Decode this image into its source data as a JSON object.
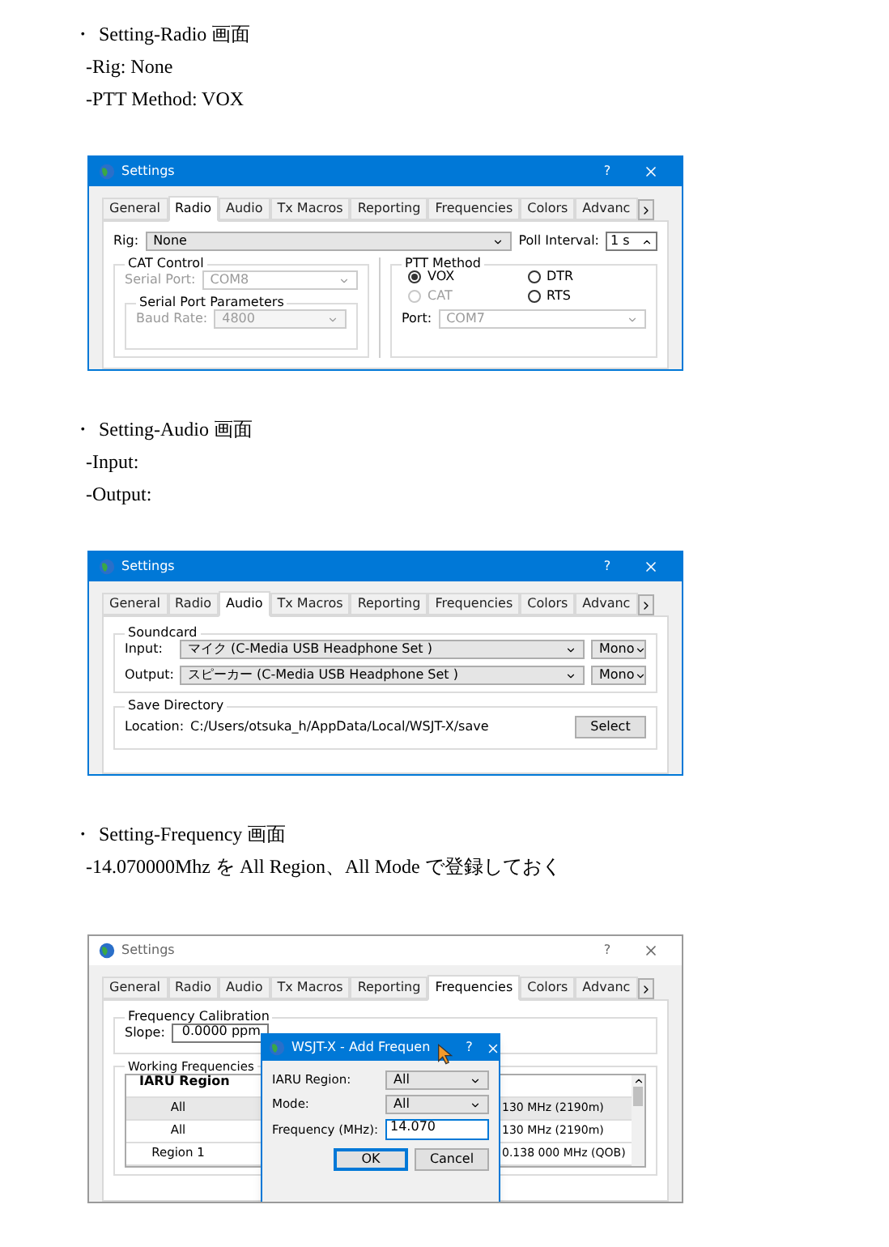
{
  "sections": [
    {
      "bullet": "・",
      "heading": "Setting-Radio 画面",
      "notes": [
        "-Rig: None",
        "-PTT Method: VOX"
      ],
      "window": {
        "kind": "radio",
        "title": "Settings",
        "active": true,
        "help": "?",
        "tabs": [
          {
            "label": "General",
            "selected": false
          },
          {
            "label": "Radio",
            "selected": true
          },
          {
            "label": "Audio",
            "selected": false
          },
          {
            "label": "Tx Macros",
            "selected": false
          },
          {
            "label": "Reporting",
            "selected": false
          },
          {
            "label": "Frequencies",
            "selected": false
          },
          {
            "label": "Colors",
            "selected": false
          },
          {
            "label": "Advanc",
            "selected": false
          }
        ],
        "rig_label": "Rig:",
        "rig_value": "None",
        "poll_label": "Poll Interval:",
        "poll_value": "1 s",
        "cat_group": "CAT Control",
        "serial_port_label": "Serial Port:",
        "serial_port_value": "COM8",
        "serial_disabled": true,
        "params_group": "Serial Port Parameters",
        "baud_label": "Baud Rate:",
        "baud_value": "4800",
        "ptt_group": "PTT Method",
        "ptt_options": [
          {
            "label": "VOX",
            "selected": true,
            "disabled": false
          },
          {
            "label": "DTR",
            "selected": false,
            "disabled": false
          },
          {
            "label": "CAT",
            "selected": false,
            "disabled": true
          },
          {
            "label": "RTS",
            "selected": false,
            "disabled": false
          }
        ],
        "port_label": "Port:",
        "port_value": "COM7"
      }
    },
    {
      "bullet": "・",
      "heading": "Setting-Audio 画面",
      "notes": [
        "-Input:",
        "-Output:"
      ],
      "window": {
        "kind": "audio",
        "title": "Settings",
        "active": true,
        "help": "?",
        "tabs": [
          {
            "label": "General",
            "selected": false
          },
          {
            "label": "Radio",
            "selected": false
          },
          {
            "label": "Audio",
            "selected": true
          },
          {
            "label": "Tx Macros",
            "selected": false
          },
          {
            "label": "Reporting",
            "selected": false
          },
          {
            "label": "Frequencies",
            "selected": false
          },
          {
            "label": "Colors",
            "selected": false
          },
          {
            "label": "Advanc",
            "selected": false
          }
        ],
        "soundcard_group": "Soundcard",
        "devices": [
          {
            "label": "Input:",
            "value": "マイク (C-Media USB Headphone Set )",
            "channel": "Mono"
          },
          {
            "label": "Output:",
            "value": "スピーカー (C-Media USB Headphone Set )",
            "channel": "Mono"
          }
        ],
        "save_group": "Save Directory",
        "location_label": "Location:",
        "location_value": "C:/Users/otsuka_h/AppData/Local/WSJT-X/save",
        "select_button": "Select"
      }
    },
    {
      "bullet": "・",
      "heading": "Setting-Frequency 画面",
      "notes": [
        "-14.070000Mhz を All Region、All Mode で登録しておく"
      ],
      "window": {
        "kind": "frequencies",
        "title": "Settings",
        "active": false,
        "help": "?",
        "tabs": [
          {
            "label": "General",
            "selected": false
          },
          {
            "label": "Radio",
            "selected": false
          },
          {
            "label": "Audio",
            "selected": false
          },
          {
            "label": "Tx Macros",
            "selected": false
          },
          {
            "label": "Reporting",
            "selected": false
          },
          {
            "label": "Frequencies",
            "selected": true
          },
          {
            "label": "Colors",
            "selected": false
          },
          {
            "label": "Advanc",
            "selected": false
          }
        ],
        "calibration_group": "Frequency Calibration",
        "slope_label": "Slope:",
        "slope_value": "0.0000 ppm",
        "working_group": "Working Frequencies",
        "table": {
          "columns": [
            "IARU Region"
          ],
          "rows": [
            {
              "region": "All",
              "frequency": "130 MHz (2190m)"
            },
            {
              "region": "All",
              "frequency": "130 MHz (2190m)"
            },
            {
              "region": "Region 1",
              "frequency": "0.138 000 MHz (QOB)"
            }
          ]
        },
        "dialog": {
          "title": "WSJT-X - Add Frequen",
          "help": "?",
          "fields": [
            {
              "kind": "combo",
              "label": "IARU Region:",
              "value": "All"
            },
            {
              "kind": "combo",
              "label": "Mode:",
              "value": "All"
            },
            {
              "kind": "input",
              "label": "Frequency (MHz):",
              "value": "14.070"
            }
          ],
          "buttons": [
            {
              "label": "OK",
              "default": true
            },
            {
              "label": "Cancel",
              "default": false
            }
          ]
        }
      }
    }
  ]
}
